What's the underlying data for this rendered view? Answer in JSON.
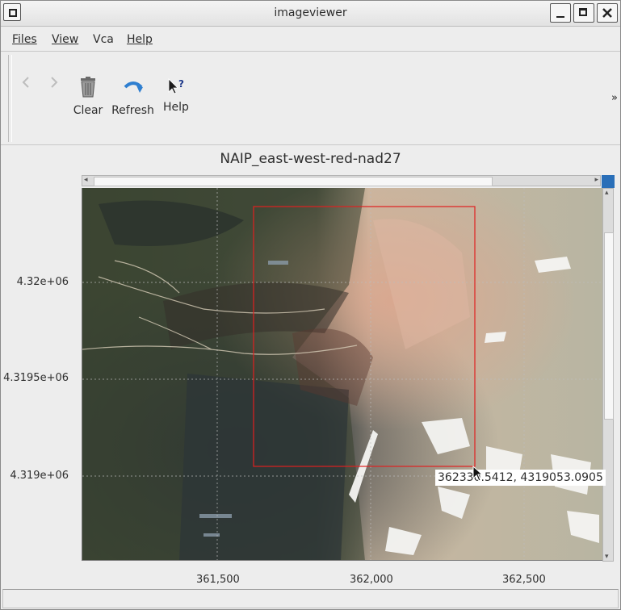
{
  "window": {
    "title": "imageviewer"
  },
  "menubar": {
    "items": [
      {
        "label": "Files"
      },
      {
        "label": "View"
      },
      {
        "label": "Vca"
      },
      {
        "label": "Help"
      }
    ]
  },
  "toolbar": {
    "back_icon": "chevron-left-icon",
    "forward_icon": "chevron-right-icon",
    "clear_label": "Clear",
    "refresh_label": "Refresh",
    "help_label": "Help",
    "overflow_label": "»"
  },
  "map": {
    "title": "NAIP_east-west-red-nad27",
    "y_ticks": [
      "4.32e+06",
      "4.3195e+06",
      "4.319e+06"
    ],
    "x_ticks": [
      "361,500",
      "362,000",
      "362,500"
    ],
    "cursor_readout": "362330.5412, 4319053.0905",
    "selection_color": "#e02020"
  },
  "statusbar": {
    "text": ""
  }
}
